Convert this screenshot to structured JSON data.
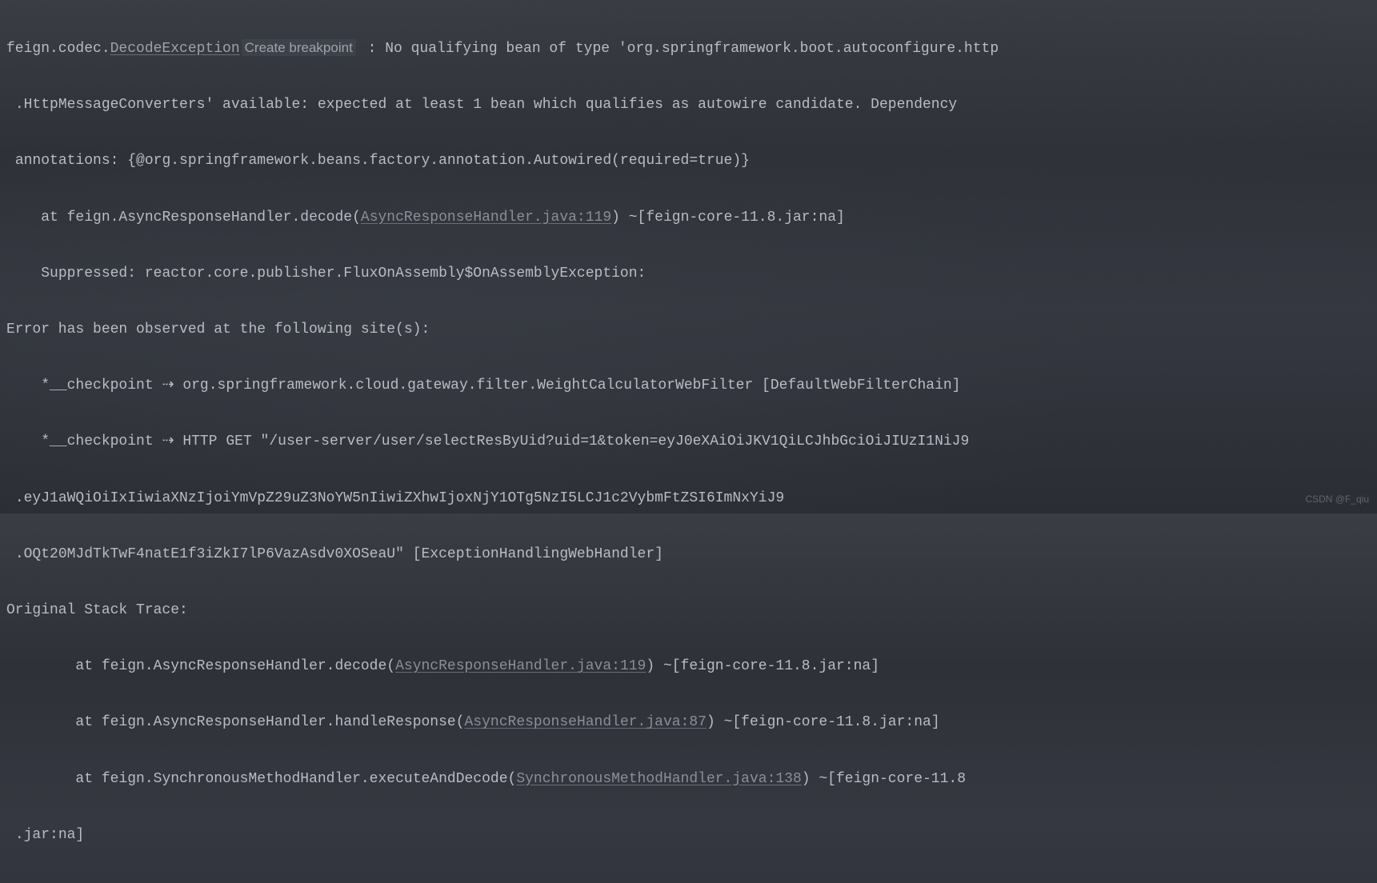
{
  "stack": {
    "line1_prefix": "feign.codec.",
    "line1_exception": "DecodeException",
    "line1_breakpoint": "Create breakpoint",
    "line1_msg": " : No qualifying bean of type 'org.springframework.boot.autoconfigure.http",
    "line2": " .HttpMessageConverters' available: expected at least 1 bean which qualifies as autowire candidate. Dependency ",
    "line3": " annotations: {@org.springframework.beans.factory.annotation.Autowired(required=true)}",
    "line4_prefix": "    at feign.AsyncResponseHandler.decode(",
    "line4_link": "AsyncResponseHandler.java:119",
    "line4_suffix": ") ~[feign-core-11.8.jar:na]",
    "line5": "    Suppressed: reactor.core.publisher.FluxOnAssembly$OnAssemblyException: ",
    "line6": "Error has been observed at the following site(s):",
    "line7": "    *__checkpoint ⇢ org.springframework.cloud.gateway.filter.WeightCalculatorWebFilter [DefaultWebFilterChain]",
    "line8": "    *__checkpoint ⇢ HTTP GET \"/user-server/user/selectResByUid?uid=1&token=eyJ0eXAiOiJKV1QiLCJhbGciOiJIUzI1NiJ9",
    "line9": " .eyJ1aWQiOiIxIiwiaXNzIjoiYmVpZ29uZ3NoYW5nIiwiZXhwIjoxNjY1OTg5NzI5LCJ1c2VybmFtZSI6ImNxYiJ9",
    "line10": " .OQt20MJdTkTwF4natE1f3iZkI7lP6VazAsdv0XOSeaU\" [ExceptionHandlingWebHandler]",
    "line11": "Original Stack Trace:",
    "line12_prefix": "        at feign.AsyncResponseHandler.decode(",
    "line12_link": "AsyncResponseHandler.java:119",
    "line12_suffix": ") ~[feign-core-11.8.jar:na]",
    "line13_prefix": "        at feign.AsyncResponseHandler.handleResponse(",
    "line13_link": "AsyncResponseHandler.java:87",
    "line13_suffix": ") ~[feign-core-11.8.jar:na]",
    "line14_prefix": "        at feign.SynchronousMethodHandler.executeAndDecode(",
    "line14_link": "SynchronousMethodHandler.java:138",
    "line14_suffix": ") ~[feign-core-11.8",
    "line15": " .jar:na]"
  },
  "watermark": "CSDN @F_qiu"
}
